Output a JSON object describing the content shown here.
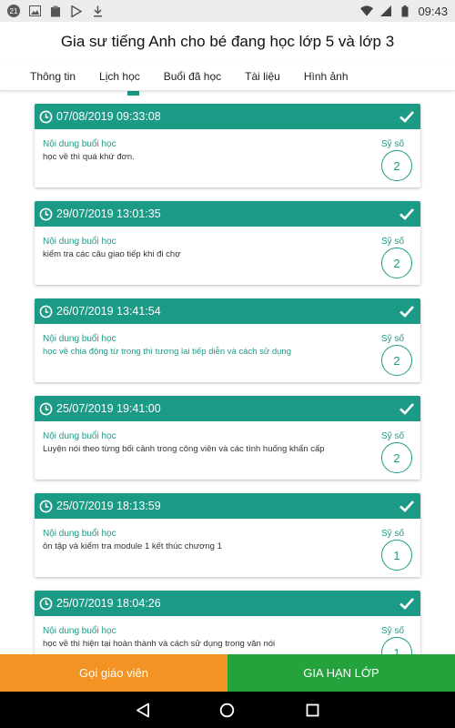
{
  "status_bar": {
    "notification_count": "21",
    "time": "09:43"
  },
  "header": {
    "title": "Gia sư tiếng Anh cho bé đang học lớp 5 và lớp 3"
  },
  "tabs": [
    "Thông tin",
    "Lịch học",
    "Buổi đã học",
    "Tài liệu",
    "Hình ảnh"
  ],
  "sessions": [
    {
      "datetime": "07/08/2019 09:33:08",
      "content_label": "Nội dung buổi học",
      "content": "học về thì quá khứ đơn.",
      "size_label": "Sỹ số",
      "count": "2"
    },
    {
      "datetime": "29/07/2019 13:01:35",
      "content_label": "Nội dung buổi học",
      "content": "kiểm tra các câu giao tiếp khi đi chợ",
      "size_label": "Sỹ số",
      "count": "2"
    },
    {
      "datetime": "26/07/2019 13:41:54",
      "content_label": "Nội dung buổi học",
      "content": "học về chia động từ trong thì tương lai tiếp diễn và cách sử dụng",
      "size_label": "Sỹ số",
      "count": "2"
    },
    {
      "datetime": "25/07/2019 19:41:00",
      "content_label": "Nội dung buổi học",
      "content": "Luyện nói theo từng bối cảnh trong công viên và các tình huống khẩn cấp",
      "size_label": "Sỹ số",
      "count": "2"
    },
    {
      "datetime": "25/07/2019 18:13:59",
      "content_label": "Nội dung buổi học",
      "content": "ôn tập và kiểm tra module 1 kết thúc chương 1",
      "size_label": "Sỹ số",
      "count": "1"
    },
    {
      "datetime": "25/07/2019 18:04:26",
      "content_label": "Nội dung buổi học",
      "content": "học về thì hiện tại hoàn thành và cách sử dụng trong văn nói",
      "size_label": "Sỹ số",
      "count": "1"
    }
  ],
  "buttons": {
    "call_teacher": "Gọi giáo viên",
    "extend_class": "GIA HẠN LỚP"
  },
  "colors": {
    "primary": "#1b9a86",
    "call": "#f39323",
    "extend": "#24a23c"
  }
}
